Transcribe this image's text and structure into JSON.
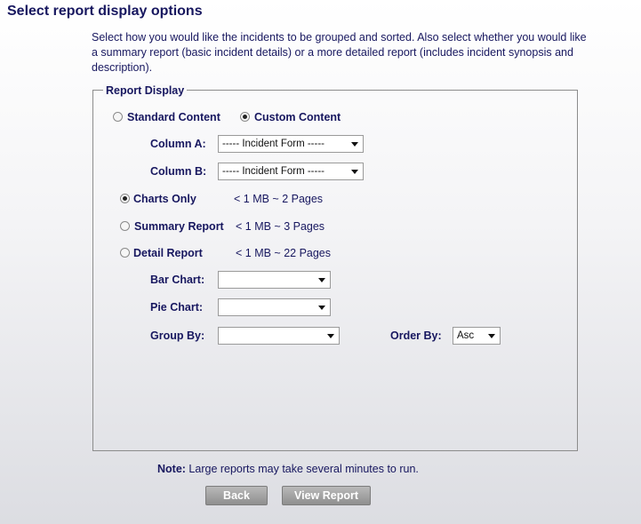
{
  "page_title": "Select report display options",
  "intro_text": "Select how you would like the incidents to be grouped and sorted. Also select whether you would like a summary report (basic incident details) or a more detailed report (includes incident synopsis and description).",
  "report_display": {
    "legend": "Report Display",
    "content_options": [
      {
        "label": "Standard Content",
        "checked": false
      },
      {
        "label": "Custom Content",
        "checked": true
      }
    ],
    "column_a": {
      "label": "Column A:",
      "value": "----- Incident Form -----"
    },
    "column_b": {
      "label": "Column B:",
      "value": "----- Incident Form -----"
    },
    "report_types": [
      {
        "label": "Charts Only",
        "size": "< 1 MB ~ 2 Pages",
        "checked": true
      },
      {
        "label": "Summary Report",
        "size": "< 1 MB ~ 3 Pages",
        "checked": false
      },
      {
        "label": "Detail Report",
        "size": "< 1 MB ~ 22 Pages",
        "checked": false
      }
    ],
    "bar_chart": {
      "label": "Bar Chart:",
      "value": ""
    },
    "pie_chart": {
      "label": "Pie Chart:",
      "value": ""
    },
    "group_by": {
      "label": "Group By:",
      "value": ""
    },
    "order_by": {
      "label": "Order By:",
      "value": "Asc"
    }
  },
  "note": {
    "label": "Note:",
    "text": " Large reports may take several minutes to run."
  },
  "buttons": {
    "back": "Back",
    "view_report": "View Report"
  }
}
